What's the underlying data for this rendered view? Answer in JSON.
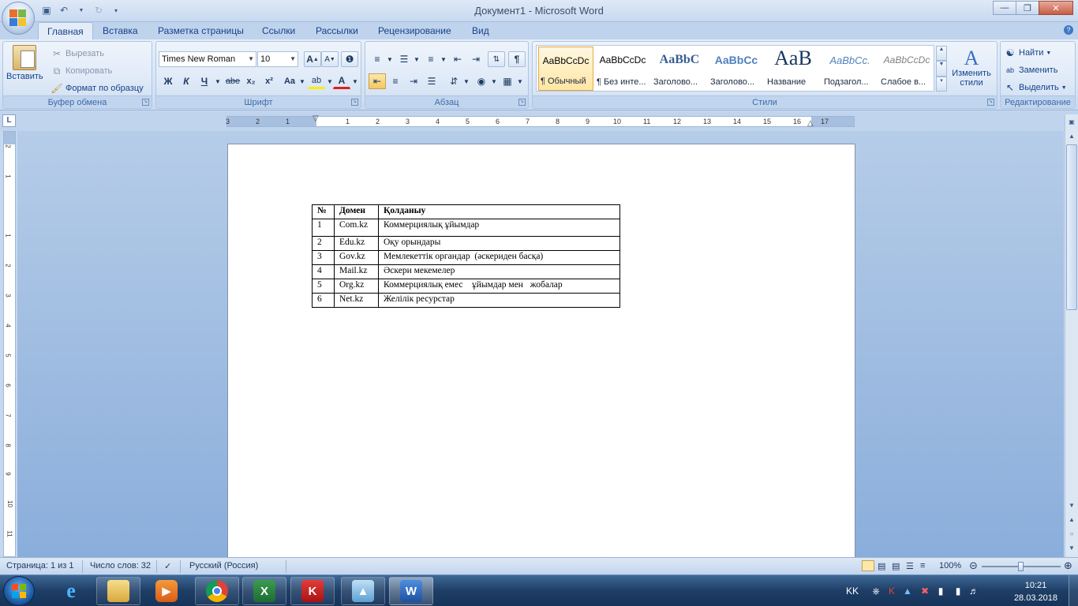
{
  "window": {
    "title": "Документ1 - Microsoft Word"
  },
  "tabs": [
    "Главная",
    "Вставка",
    "Разметка страницы",
    "Ссылки",
    "Рассылки",
    "Рецензирование",
    "Вид"
  ],
  "ribbon": {
    "clipboard": {
      "paste": "Вставить",
      "cut": "Вырезать",
      "copy": "Копировать",
      "format_painter": "Формат по образцу",
      "label": "Буфер обмена"
    },
    "font": {
      "name": "Times New Roman",
      "size": "10",
      "bold": "Ж",
      "italic": "К",
      "underline": "Ч",
      "strike": "abe",
      "subscript": "x₂",
      "superscript": "x²",
      "case": "Aa",
      "highlight": "ab",
      "color": "A",
      "grow": "A",
      "shrink": "A",
      "label": "Шрифт"
    },
    "paragraph": {
      "label": "Абзац"
    },
    "styles": {
      "items": [
        {
          "sample": "AaBbCcDc",
          "name": "¶ Обычный"
        },
        {
          "sample": "AaBbCcDc",
          "name": "¶ Без инте..."
        },
        {
          "sample": "AaBbC",
          "name": "Заголово..."
        },
        {
          "sample": "AaBbCc",
          "name": "Заголово..."
        },
        {
          "sample": "AaB",
          "name": "Название"
        },
        {
          "sample": "AaBbCc.",
          "name": "Подзагол..."
        },
        {
          "sample": "AaBbCcDc",
          "name": "Слабое в..."
        }
      ],
      "change_styles": "Изменить стили",
      "label": "Стили"
    },
    "editing": {
      "find": "Найти",
      "replace": "Заменить",
      "select": "Выделить",
      "label": "Редактирование"
    }
  },
  "ruler": {
    "ticks": [
      "3",
      "2",
      "1",
      "1",
      "2",
      "3",
      "4",
      "5",
      "6",
      "7",
      "8",
      "9",
      "10",
      "11",
      "12",
      "13",
      "14",
      "15",
      "16",
      "17"
    ],
    "vticks": [
      "2",
      "1",
      "1",
      "2",
      "3",
      "4",
      "5",
      "6",
      "7",
      "8",
      "9",
      "10",
      "11"
    ]
  },
  "document": {
    "table": {
      "headers": [
        "№",
        "Домен",
        "Қолданыу"
      ],
      "rows": [
        [
          "1",
          "Com.kz",
          "Коммерциялық ұйымдар"
        ],
        [
          "2",
          "Edu.kz",
          "Оқу орындары"
        ],
        [
          "3",
          "Gov.kz",
          "Мемлекеттік органдар  (әскериден басқа)"
        ],
        [
          "4",
          "Mail.kz",
          "Әскери мекемелер"
        ],
        [
          "5",
          "Org.kz",
          "Коммерциялық емес    ұйымдар мен   жобалар"
        ],
        [
          "6",
          "Net.kz",
          "Желілік ресурстар"
        ]
      ]
    }
  },
  "statusbar": {
    "page": "Страница: 1 из 1",
    "words": "Число слов: 32",
    "language": "Русский (Россия)",
    "zoom": "100%"
  },
  "taskbar": {
    "language": "KK",
    "time": "10:21",
    "date": "28.03.2018"
  },
  "colors": {
    "accent": "#15428b",
    "ribbon_bg": "#dbe7f6",
    "workspace": "#9dbbe2"
  }
}
